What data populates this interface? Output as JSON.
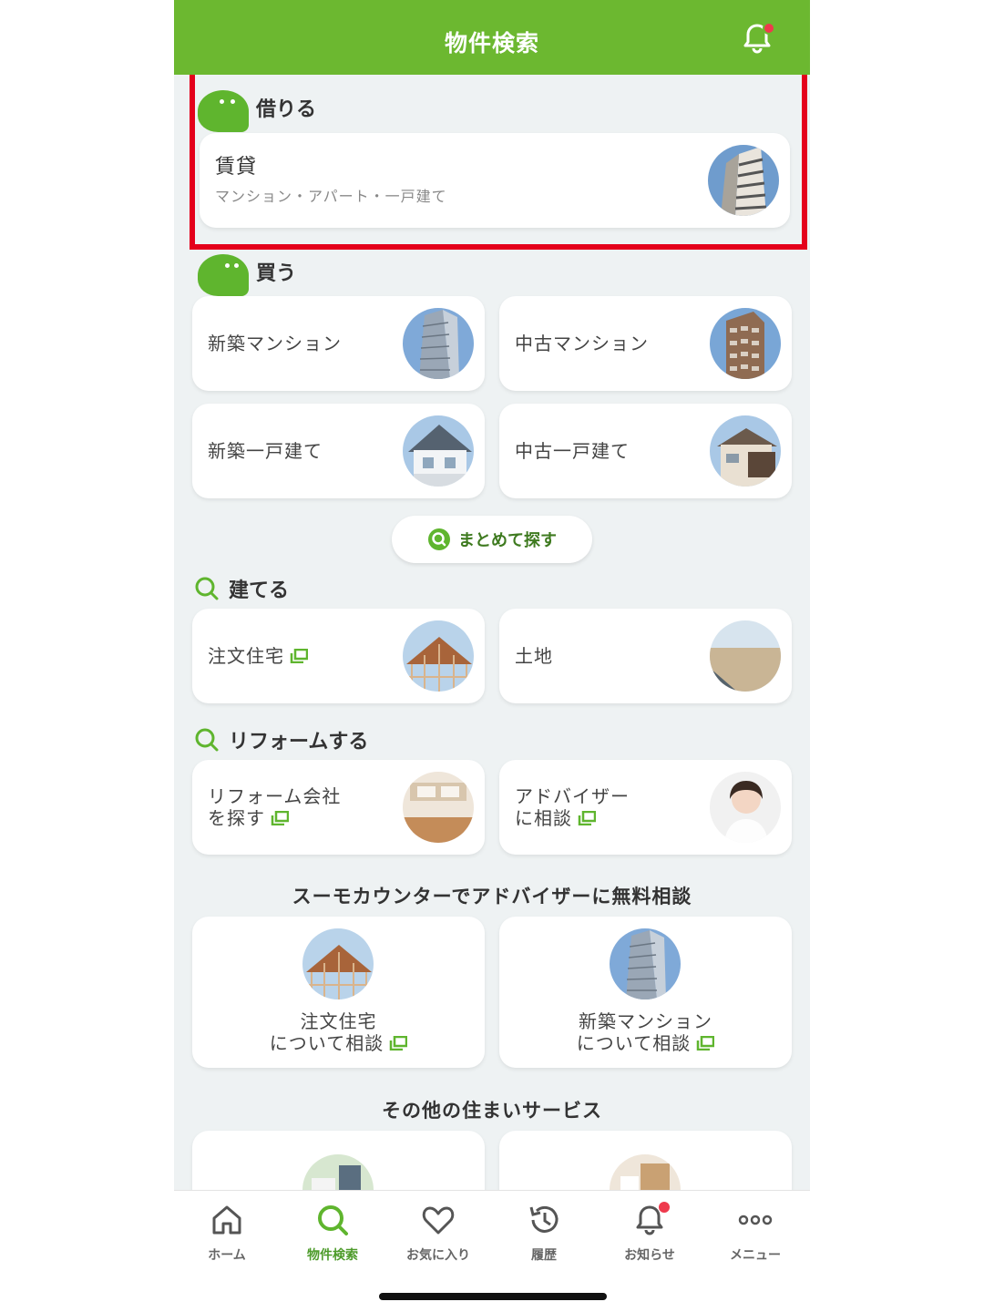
{
  "header": {
    "title": "物件検索"
  },
  "rent": {
    "heading": "借りる",
    "card": {
      "title": "賃貸",
      "subtitle": "マンション・アパート・一戸建て"
    }
  },
  "buy": {
    "heading": "買う",
    "items": [
      {
        "label": "新築マンション"
      },
      {
        "label": "中古マンション"
      },
      {
        "label": "新築一戸建て"
      },
      {
        "label": "中古一戸建て"
      }
    ],
    "search_all_label": "まとめて探す"
  },
  "build": {
    "heading": "建てる",
    "items": [
      {
        "label": "注文住宅"
      },
      {
        "label": "土地"
      }
    ]
  },
  "reform": {
    "heading": "リフォームする",
    "items": [
      {
        "line1": "リフォーム会社",
        "line2": "を探す"
      },
      {
        "line1": "アドバイザー",
        "line2": "に相談"
      }
    ]
  },
  "counter": {
    "heading": "スーモカウンターでアドバイザーに無料相談",
    "items": [
      {
        "line1": "注文住宅",
        "line2": "について相談"
      },
      {
        "line1": "新築マンション",
        "line2": "について相談"
      }
    ]
  },
  "other": {
    "heading": "その他の住まいサービス"
  },
  "nav": {
    "items": [
      {
        "label": "ホーム"
      },
      {
        "label": "物件検索"
      },
      {
        "label": "お気に入り"
      },
      {
        "label": "履歴"
      },
      {
        "label": "お知らせ"
      },
      {
        "label": "メニュー"
      }
    ],
    "active_index": 1
  },
  "colors": {
    "brand_green": "#6cb830",
    "highlight_red": "#e4001b",
    "badge_red": "#ee3a4d"
  }
}
